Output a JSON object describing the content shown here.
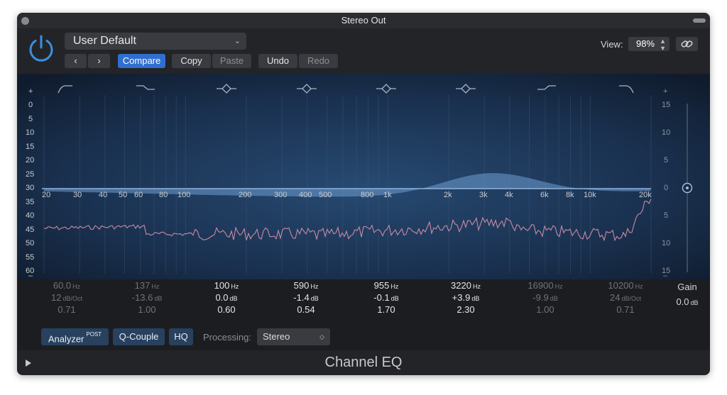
{
  "window": {
    "title": "Stereo Out"
  },
  "toolbar": {
    "preset": "User Default",
    "compare": "Compare",
    "copy": "Copy",
    "paste": "Paste",
    "undo": "Undo",
    "redo": "Redo",
    "view_label": "View:",
    "view_value": "98%"
  },
  "graph": {
    "left_plus": "+",
    "left_minus": "–",
    "right_plus": "+",
    "right_minus": "–",
    "db_scale_left": [
      "0",
      "5",
      "10",
      "15",
      "20",
      "25",
      "30",
      "35",
      "40",
      "45",
      "50",
      "55",
      "60"
    ],
    "db_scale_right": [
      "15",
      "10",
      "5",
      "0",
      "5",
      "10",
      "15"
    ],
    "freq_labels": [
      "20",
      "30",
      "40",
      "50",
      "60",
      "80",
      "100",
      "200",
      "300",
      "400",
      "500",
      "800",
      "1k",
      "2k",
      "3k",
      "4k",
      "6k",
      "8k",
      "10k",
      "20k"
    ],
    "band_icons": [
      "low-cut-icon",
      "low-shelf-icon",
      "bell-icon",
      "bell-icon",
      "bell-icon",
      "bell-icon",
      "high-shelf-icon",
      "high-cut-icon"
    ]
  },
  "bands": [
    {
      "freq": "60.0",
      "freq_unit": "Hz",
      "gain": "12",
      "gain_unit": "dB/Oct",
      "q": "0.71",
      "enabled": false
    },
    {
      "freq": "137",
      "freq_unit": "Hz",
      "gain": "-13.6",
      "gain_unit": "dB",
      "q": "1.00",
      "enabled": false
    },
    {
      "freq": "100",
      "freq_unit": "Hz",
      "gain": "0.0",
      "gain_unit": "dB",
      "q": "0.60",
      "enabled": true
    },
    {
      "freq": "590",
      "freq_unit": "Hz",
      "gain": "-1.4",
      "gain_unit": "dB",
      "q": "0.54",
      "enabled": true
    },
    {
      "freq": "955",
      "freq_unit": "Hz",
      "gain": "-0.1",
      "gain_unit": "dB",
      "q": "1.70",
      "enabled": true
    },
    {
      "freq": "3220",
      "freq_unit": "Hz",
      "gain": "+3.9",
      "gain_unit": "dB",
      "q": "2.30",
      "enabled": true
    },
    {
      "freq": "16900",
      "freq_unit": "Hz",
      "gain": "-9.9",
      "gain_unit": "dB",
      "q": "1.00",
      "enabled": false
    },
    {
      "freq": "10200",
      "freq_unit": "Hz",
      "gain": "24",
      "gain_unit": "dB/Oct",
      "q": "0.71",
      "enabled": false
    }
  ],
  "gain": {
    "label": "Gain",
    "value": "0.0",
    "unit": "dB"
  },
  "bottom": {
    "analyzer": "Analyzer",
    "analyzer_sup": "POST",
    "q_couple": "Q-Couple",
    "hq": "HQ",
    "processing_label": "Processing:",
    "processing_value": "Stereo"
  },
  "footer": {
    "plugin_name": "Channel EQ"
  },
  "colors": {
    "accent": "#2f6fd0",
    "power": "#3a8fe0",
    "eq_fill": "#6f9fd2",
    "analyzer": "#c98aa6"
  }
}
